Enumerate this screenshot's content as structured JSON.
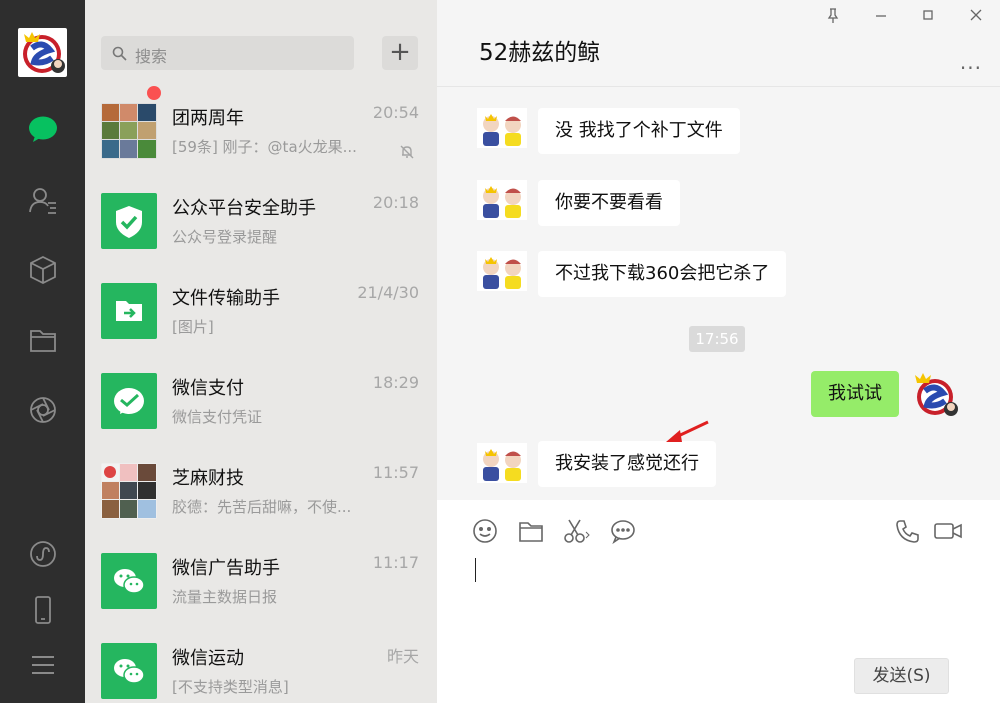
{
  "search": {
    "placeholder": "搜索"
  },
  "conversations": [
    {
      "name": "团两周年",
      "time": "20:54",
      "preview": "[59条] 刚子：@ta火龙果...",
      "icon": "group-avatar",
      "unread": true,
      "muted": true
    },
    {
      "name": "公众平台安全助手",
      "time": "20:18",
      "preview": "公众号登录提醒",
      "icon": "shield-check-icon"
    },
    {
      "name": "文件传输助手",
      "time": "21/4/30",
      "preview": "[图片]",
      "icon": "file-transfer-icon"
    },
    {
      "name": "微信支付",
      "time": "18:29",
      "preview": "微信支付凭证",
      "icon": "wechat-pay-icon"
    },
    {
      "name": "芝麻财技",
      "time": "11:57",
      "preview": "胶德：先苦后甜嘛，不使...",
      "icon": "group-avatar"
    },
    {
      "name": "微信广告助手",
      "time": "11:17",
      "preview": "流量主数据日报",
      "icon": "wechat-bubble-icon"
    },
    {
      "name": "微信运动",
      "time": "昨天",
      "preview": "[不支持类型消息]",
      "icon": "wechat-bubble-icon"
    }
  ],
  "chat": {
    "title": "52赫兹的鲸",
    "more": "...",
    "timestamp": "17:56",
    "messages": [
      {
        "text": "没 我找了个补丁文件",
        "from": "other"
      },
      {
        "text": "你要不要看看",
        "from": "other"
      },
      {
        "text": "不过我下载360会把它杀了",
        "from": "other"
      },
      {
        "text": "我试试",
        "from": "me"
      },
      {
        "text": "我安装了感觉还行",
        "from": "other"
      }
    ],
    "send_label": "发送(S)"
  },
  "colors": {
    "accent": "#07c160",
    "bubble_me": "#95ec69",
    "nav_bg": "#2e2e2e",
    "arrow": "#e02020"
  }
}
